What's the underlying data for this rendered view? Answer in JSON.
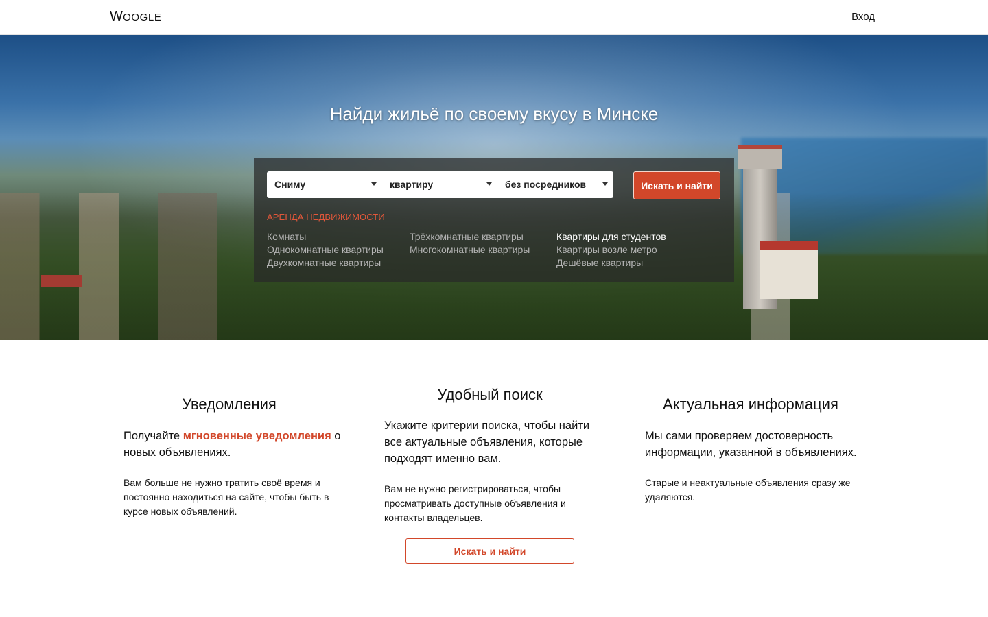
{
  "header": {
    "logo_first": "W",
    "logo_rest": "OOGLE",
    "login": "Вход"
  },
  "hero": {
    "title": "Найди жильё по своему вкусу в Минске",
    "selects": [
      {
        "value": "Сниму"
      },
      {
        "value": "квартиру"
      },
      {
        "value": "без посредников"
      }
    ],
    "search_button": "Искать и найти",
    "category_heading": "Аренда недвижимости",
    "links": [
      [
        {
          "label": "Комнаты"
        },
        {
          "label": "Однокомнатные квартиры"
        },
        {
          "label": "Двухкомнатные квартиры"
        }
      ],
      [
        {
          "label": "Трёхкомнатные квартиры"
        },
        {
          "label": "Многокомнатные квартиры"
        }
      ],
      [
        {
          "label": "Квартиры для студентов",
          "highlighted": true
        },
        {
          "label": "Квартиры возле метро"
        },
        {
          "label": "Дешёвые квартиры"
        }
      ]
    ]
  },
  "features": [
    {
      "title": "Уведомления",
      "lead_before": "Получайте ",
      "lead_accent": "мгновенные уведомления",
      "lead_after": " о новых объявлениях.",
      "desc": "Вам больше не нужно тратить своё время и постоянно находиться на сайте, чтобы быть в курсе новых объявлений."
    },
    {
      "title": "Удобный поиск",
      "lead": "Укажите критерии поиска, чтобы найти все актуальные объявления, которые подходят именно вам.",
      "desc": "Вам не нужно регистрироваться, чтобы просматривать доступные объявления и контакты владельцев."
    },
    {
      "title": "Актуальная информация",
      "lead": "Мы сами проверяем достоверность информации, указанной в объявлениях.",
      "desc": "Старые и неактуальные объявления сразу же удаляются."
    }
  ],
  "bottom_button": "Искать и найти",
  "colors": {
    "accent": "#d2472a",
    "panel": "rgba(40,40,40,0.72)",
    "link_muted": "#b4b4b4"
  }
}
